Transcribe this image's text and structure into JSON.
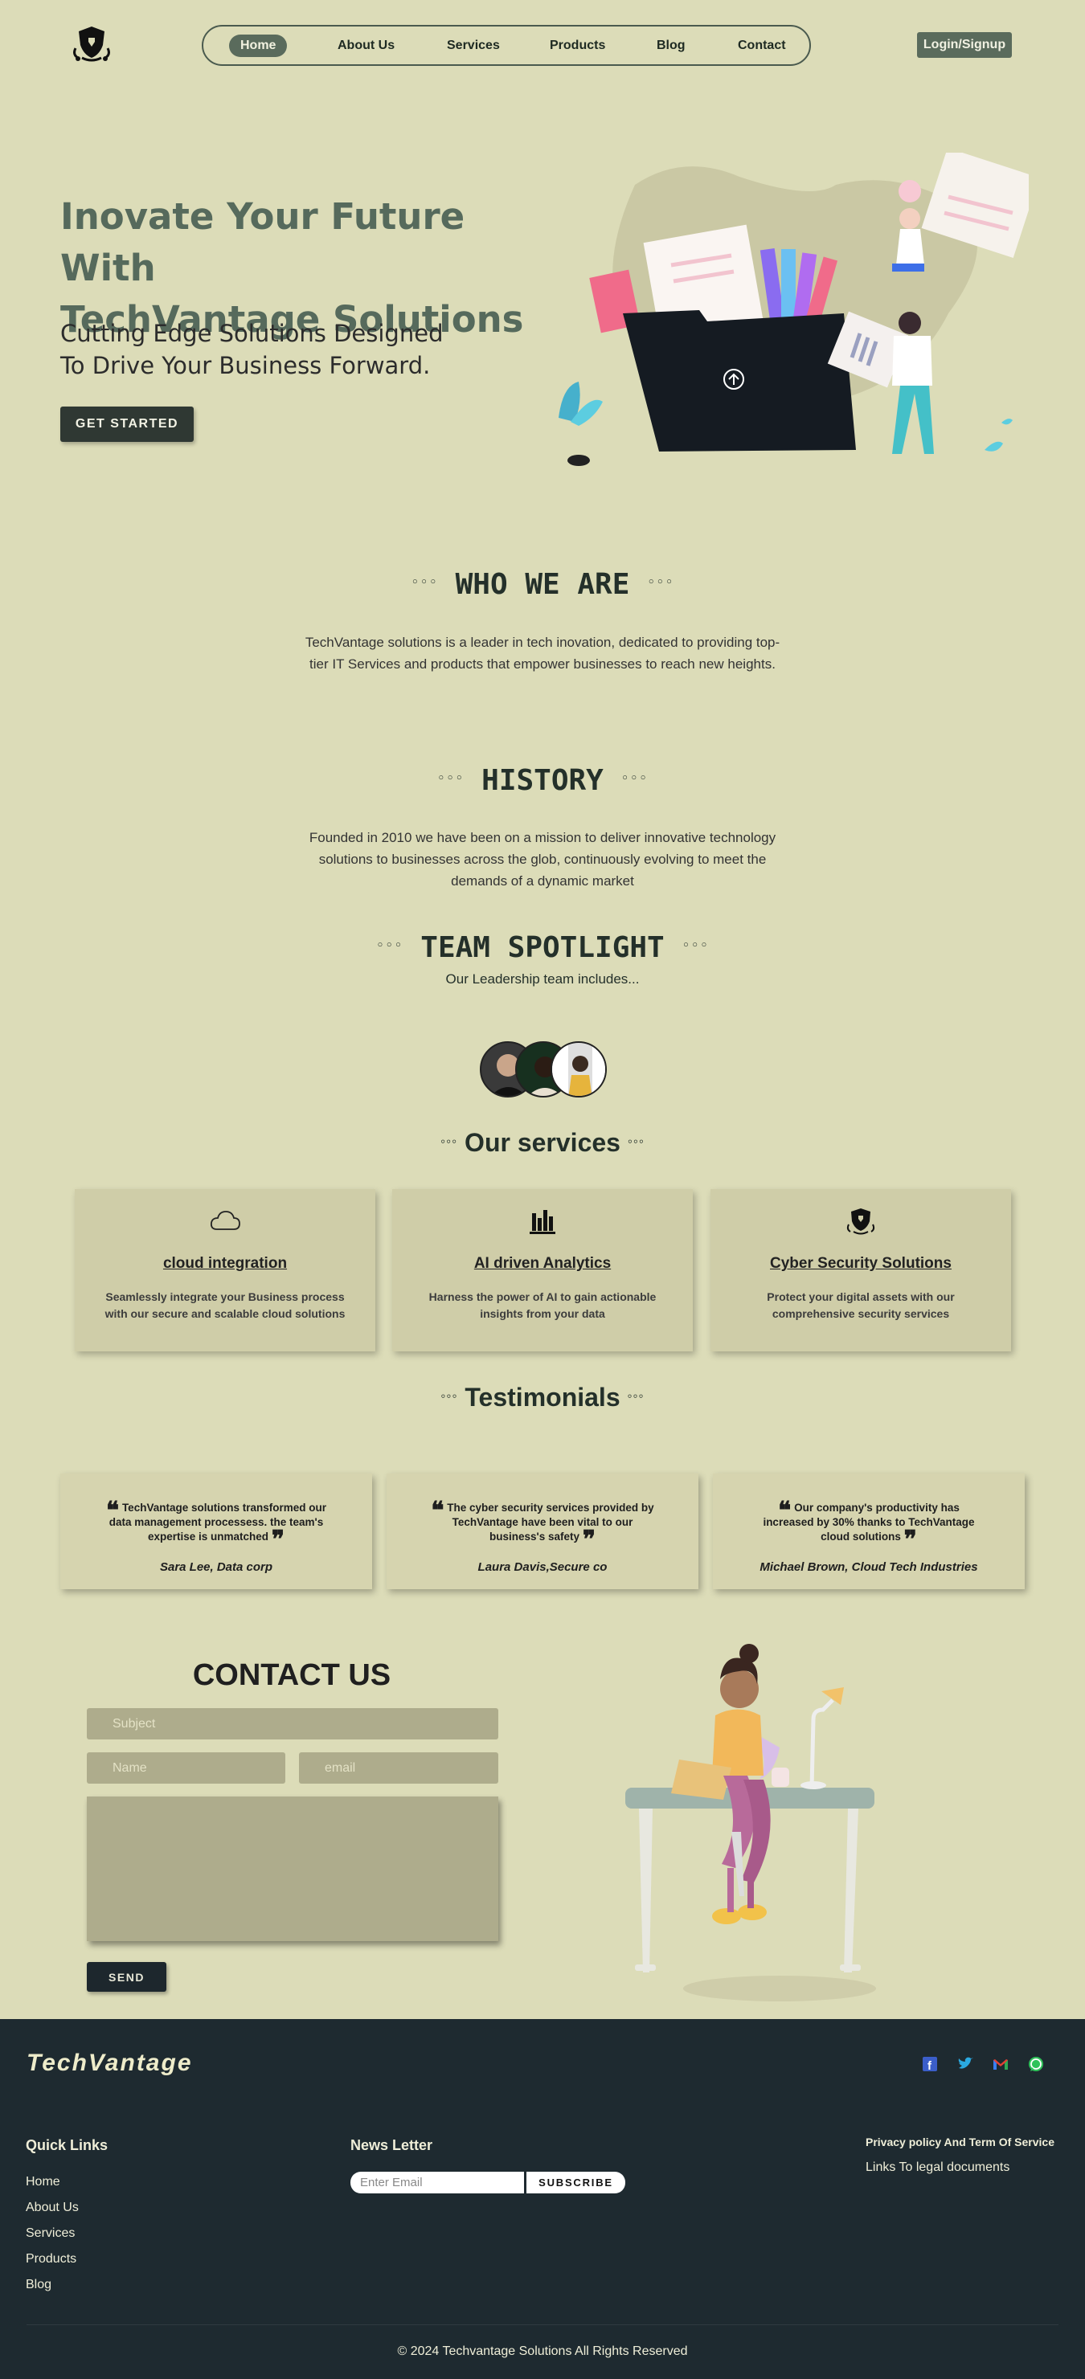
{
  "nav": {
    "items": [
      "Home",
      "About Us",
      "Services",
      "Products",
      "Blog",
      "Contact"
    ],
    "active": "Home",
    "login_label": "Login/Signup"
  },
  "hero": {
    "title_line1": "Inovate Your Future With",
    "title_line2": "TechVantage Solutions",
    "subtitle_line1": "Cutting Edge Solutions Designed",
    "subtitle_line2": "To Drive Your Business Forward.",
    "cta_label": "GET STARTED"
  },
  "decor": {
    "dots": "◦◦◦"
  },
  "about": {
    "title": "WHO WE ARE",
    "text": "TechVantage solutions is a leader in tech inovation, dedicated to providing top-tier IT Services and products that empower businesses to reach new heights."
  },
  "history": {
    "title": "HISTORY",
    "text": "Founded in 2010 we have been on a mission to deliver innovative technology solutions to businesses across the glob, continuously evolving to meet the demands of a dynamic market"
  },
  "team": {
    "title": "TEAM SPOTLIGHT",
    "subtitle": "Our Leadership team includes..."
  },
  "services": {
    "title": "Our services",
    "items": [
      {
        "icon": "cloud-icon",
        "title": "cloud integration",
        "text": "Seamlessly integrate your Business process with our secure and scalable cloud solutions"
      },
      {
        "icon": "bar-chart-icon",
        "title": "AI driven Analytics",
        "text": "Harness the power of AI to gain actionable insights from your data"
      },
      {
        "icon": "shield-icon",
        "title": "Cyber Security Solutions",
        "text": "Protect your digital assets with our comprehensive security services"
      }
    ]
  },
  "testimonials": {
    "title": "Testimonials",
    "open_quote": "❝",
    "close_quote": "❞",
    "items": [
      {
        "quote": "TechVantage solutions transformed our data management processess. the team's expertise is unmatched",
        "author": "Sara Lee, Data corp"
      },
      {
        "quote": "The cyber security services provided by TechVantage have been vital to our business's safety",
        "author": "Laura Davis,Secure co"
      },
      {
        "quote": "Our company's productivity has increased by 30% thanks to TechVantage cloud solutions",
        "author": "Michael Brown, Cloud Tech Industries"
      }
    ]
  },
  "contact": {
    "title": "CONTACT US",
    "subject_placeholder": "Subject",
    "name_placeholder": "Name",
    "email_placeholder": "email",
    "send_label": "SEND"
  },
  "footer": {
    "brand": "TechVantage",
    "social": [
      "facebook-icon",
      "twitter-icon",
      "gmail-icon",
      "whatsapp-icon"
    ],
    "quick_links_title": "Quick Links",
    "quick_links": [
      "Home",
      "About Us",
      "Services",
      "Products",
      "Blog"
    ],
    "newsletter_title": "News Letter",
    "newsletter_placeholder": "Enter Email",
    "subscribe_label": "SUBSCRIBE",
    "legal_title": "Privacy policy And Term Of Service",
    "legal_link": "Links To legal documents",
    "copyright": "© 2024 Techvantage Solutions All Rights Reserved"
  },
  "colors": {
    "background": "#dcdcb8",
    "accent": "#5a6b5c",
    "hero_title": "#566a5c",
    "card": "#cfcda8",
    "footer": "#1e2a30"
  }
}
